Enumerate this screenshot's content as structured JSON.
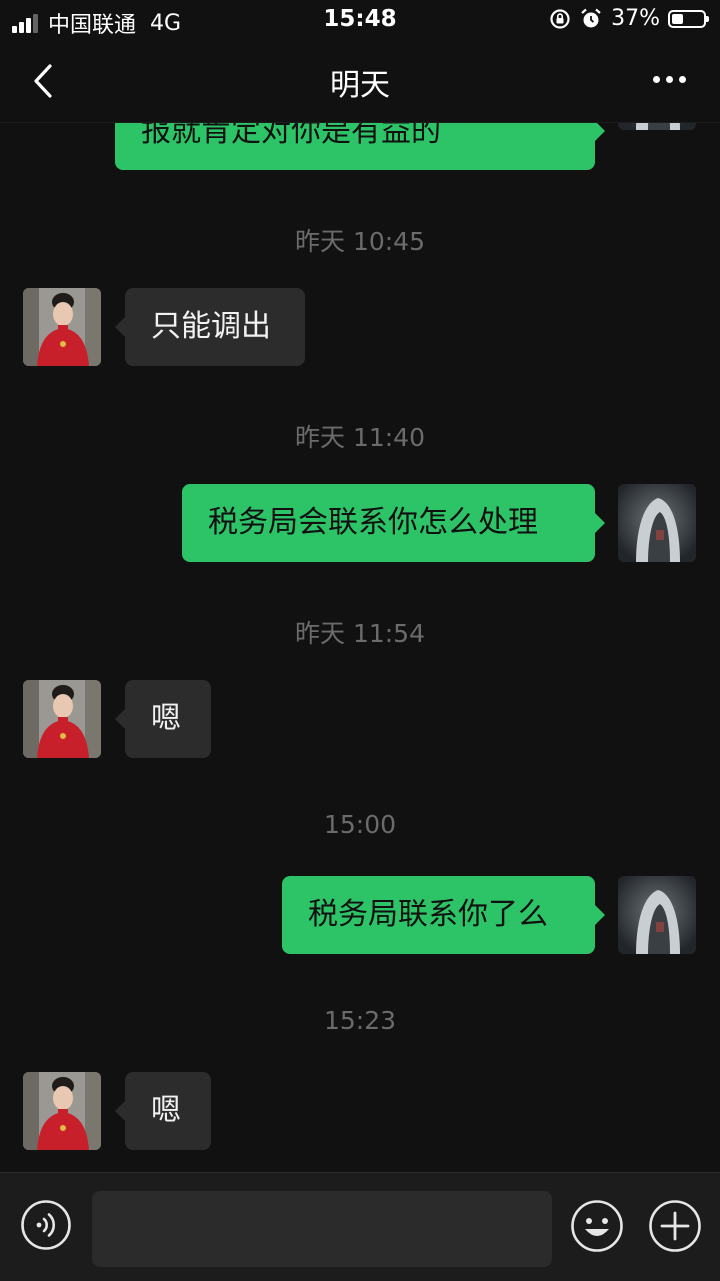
{
  "status_bar": {
    "carrier": "中国联通",
    "network": "4G",
    "time": "15:48",
    "battery": "37%",
    "battery_level": 0.37
  },
  "nav": {
    "title": "明天",
    "back_icon": "chevron-left-icon",
    "more_icon": "more-dots-icon"
  },
  "messages": {
    "m0": {
      "direction": "out",
      "text": "报就肯定对你是有益的"
    },
    "t1": "昨天 10:45",
    "m1": {
      "direction": "in",
      "text": "只能调出"
    },
    "t2": "昨天 11:40",
    "m2": {
      "direction": "out",
      "text": "税务局会联系你怎么处理"
    },
    "t3": "昨天 11:54",
    "m3": {
      "direction": "in",
      "text": "嗯"
    },
    "t4": "15:00",
    "m4": {
      "direction": "out",
      "text": "税务局联系你了么"
    },
    "t5": "15:23",
    "m5": {
      "direction": "in",
      "text": "嗯"
    }
  },
  "input_bar": {
    "voice_icon": "voice-icon",
    "emoji_icon": "emoji-icon",
    "plus_icon": "plus-icon"
  },
  "colors": {
    "background": "#111111",
    "outgoing_bubble": "#2dc467",
    "incoming_bubble": "#2c2c2c",
    "timestamp": "#6b6b6b"
  }
}
